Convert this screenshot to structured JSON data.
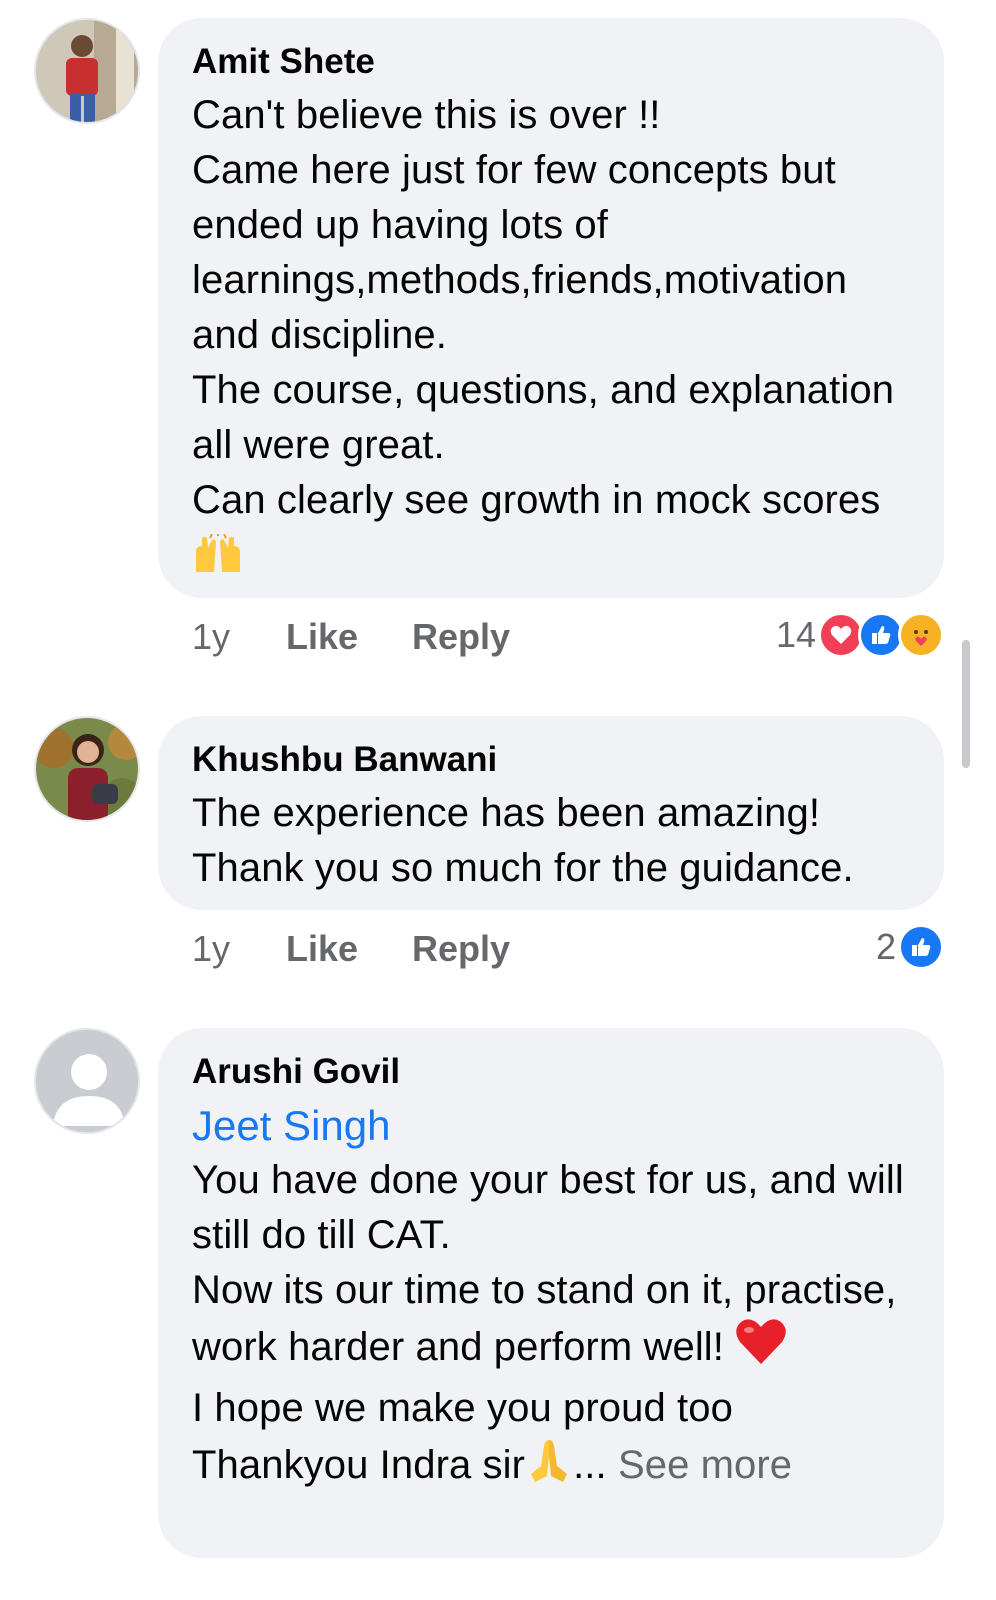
{
  "comments": [
    {
      "author": "Amit Shete",
      "text": "Can't believe this is over !!\nCame here just for few concepts but ended up having lots of learnings,methods,friends,motivation and discipline.\nThe course, questions, and explanation all were great.\nCan clearly see growth in mock scores",
      "time": "1y",
      "like_label": "Like",
      "reply_label": "Reply",
      "reaction_count": "14",
      "reactions": [
        "love-icon",
        "like-icon",
        "care-icon"
      ]
    },
    {
      "author": "Khushbu Banwani",
      "text": "The experience has been amazing!\nThank you so much for the guidance.",
      "time": "1y",
      "like_label": "Like",
      "reply_label": "Reply",
      "reaction_count": "2",
      "reactions": [
        "like-icon"
      ]
    },
    {
      "author": "Arushi Govil",
      "mention": "Jeet Singh",
      "text_line1": "You have done your best for us, and will still do till CAT.\nNow its our time to stand on it, practise, work harder and perform well!",
      "text_line2": "I hope we make you proud too\nThankyou Indra sir",
      "see_more_label": "See more",
      "ellipsis": "..."
    }
  ],
  "colors": {
    "bubble": "#f0f2f5",
    "link": "#1877f2",
    "muted": "#65676b",
    "love": "#f33e58",
    "care": "#f7b125"
  }
}
